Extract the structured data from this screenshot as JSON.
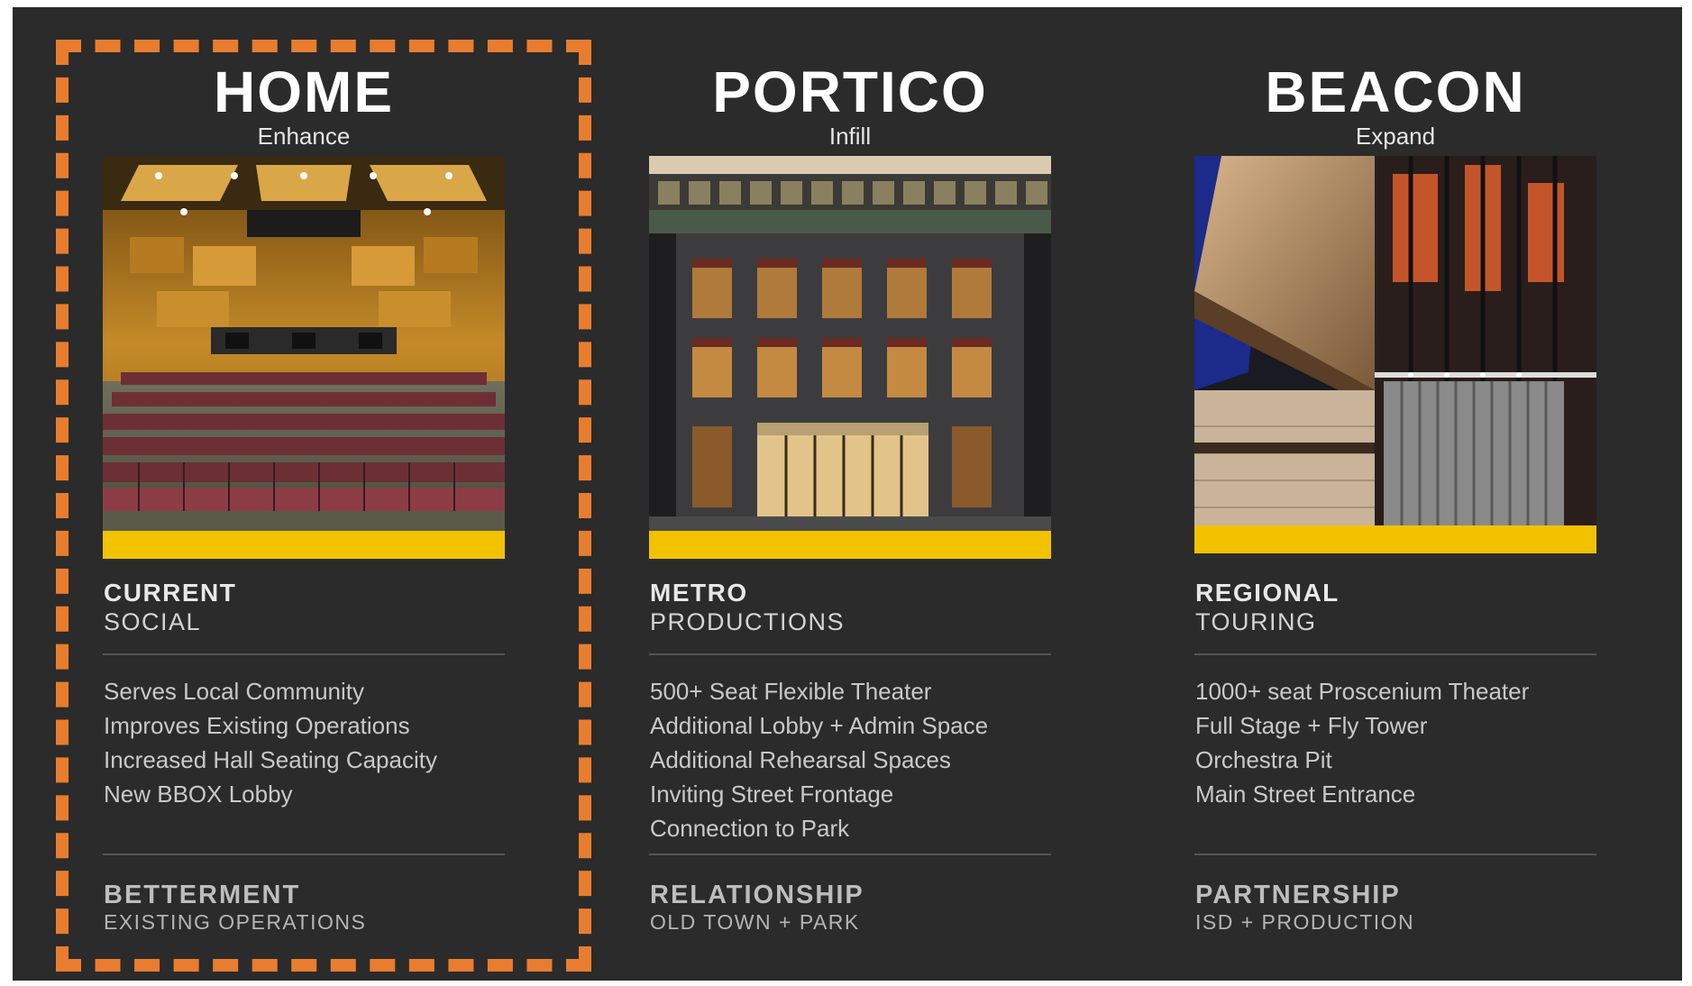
{
  "colors": {
    "background": "#2b2b2b",
    "highlight_dash": "#e87d2f",
    "accent_bar": "#f2c200"
  },
  "columns": [
    {
      "title": "HOME",
      "subtitle": "Enhance",
      "photo_icon": "auditorium-photo",
      "category_line1": "CURRENT",
      "category_line2": "SOCIAL",
      "features": [
        "Serves Local Community",
        "Improves Existing Operations",
        "Increased Hall Seating Capacity",
        "New BBOX Lobby"
      ],
      "footer_line1": "BETTERMENT",
      "footer_line2": "EXISTING OPERATIONS"
    },
    {
      "title": "PORTICO",
      "subtitle": "Infill",
      "photo_icon": "building-facade-photo",
      "category_line1": "METRO",
      "category_line2": "PRODUCTIONS",
      "features": [
        "500+ Seat Flexible Theater",
        "Additional Lobby + Admin Space",
        "Additional Rehearsal Spaces",
        "Inviting Street Frontage",
        "Connection to Park"
      ],
      "footer_line1": "RELATIONSHIP",
      "footer_line2": "OLD TOWN + PARK"
    },
    {
      "title": "BEACON",
      "subtitle": "Expand",
      "photo_icon": "fly-tower-stage-photo",
      "category_line1": "REGIONAL",
      "category_line2": "TOURING",
      "features": [
        "1000+ seat Proscenium Theater",
        "Full Stage + Fly Tower",
        "Orchestra Pit",
        "Main Street Entrance"
      ],
      "footer_line1": "PARTNERSHIP",
      "footer_line2": "ISD + PRODUCTION"
    }
  ]
}
